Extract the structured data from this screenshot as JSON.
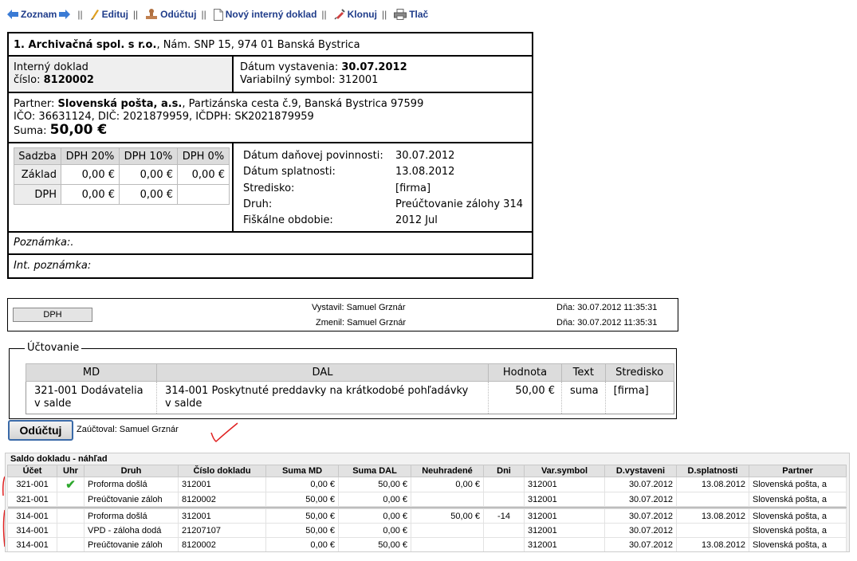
{
  "toolbar": {
    "zoznam": "Zoznam",
    "edituj": "Edituj",
    "oductuj": "Odúčtuj",
    "novy": "Nový interný doklad",
    "klonuj": "Klonuj",
    "tlac": "Tlač",
    "sep": "||"
  },
  "doc": {
    "company_name": "1. Archivačná spol. s r.o.",
    "company_addr": ", Nám. SNP 15, 974 01 Banská Bystrica",
    "type_label": "Interný doklad",
    "number_label": "číslo:",
    "number": "8120002",
    "issue_label": "Dátum vystavenia:",
    "issue_date": "30.07.2012",
    "vs_label": "Variabilný symbol:",
    "vs": "312001",
    "partner_label": "Partner:",
    "partner_name": "Slovenská pošta, a.s.",
    "partner_addr": ", Partizánska cesta č.9, Banská Bystrica 97599",
    "ids": "IČO: 36631124, DIČ: 2021879959, IČDPH: SK2021879959",
    "suma_label": "Suma:",
    "suma": "50,00 €",
    "vat": {
      "h0": "Sadzba",
      "h1": "DPH 20%",
      "h2": "DPH 10%",
      "h3": "DPH 0%",
      "r1": "Základ",
      "r1v1": "0,00 €",
      "r1v2": "0,00 €",
      "r1v3": "0,00 €",
      "r2": "DPH",
      "r2v1": "0,00 €",
      "r2v2": "0,00 €"
    },
    "kv": [
      {
        "k": "Dátum daňovej povinnosti:",
        "v": "30.07.2012"
      },
      {
        "k": "Dátum splatnosti:",
        "v": "13.08.2012"
      },
      {
        "k": "Stredisko:",
        "v": "[firma]"
      },
      {
        "k": "Druh:",
        "v": "Preúčtovanie zálohy 314"
      },
      {
        "k": "Fiškálne obdobie:",
        "v": "2012 Jul"
      }
    ],
    "note": "Poznámka:.",
    "int_note": "Int. poznámka:"
  },
  "meta": {
    "dph_btn": "DPH",
    "vystavil": "Vystavil: Samuel Grznár",
    "zmenil": "Zmenil: Samuel Grznár",
    "dna1": "Dňa: 30.07.2012 11:35:31",
    "dna2": "Dňa: 30.07.2012 11:35:31"
  },
  "uctovanie": {
    "legend": "Účtovanie",
    "headers": [
      "MD",
      "DAL",
      "Hodnota",
      "Text",
      "Stredisko"
    ],
    "row": {
      "md1": "321-001 Dodávatelia",
      "md2": "v salde",
      "dal1": "314-001 Poskytnuté preddavky na krátkodobé pohľadávky",
      "dal2": "v salde",
      "hodnota": "50,00 €",
      "text": "suma",
      "stredisko": "[firma]"
    }
  },
  "oductuj_button": "Odúčtuj",
  "zauctoval": "Zaúčtoval: Samuel Grznár",
  "saldo": {
    "title": "Saldo dokladu - náhľad",
    "headers": [
      "Účet",
      "Uhr",
      "Druh",
      "Číslo dokladu",
      "Suma MD",
      "Suma DAL",
      "Neuhradené",
      "Dni",
      "Var.symbol",
      "D.vystaveni",
      "D.splatnosti",
      "Partner"
    ],
    "rows": [
      [
        "321-001",
        "✔",
        "Proforma došlá",
        "312001",
        "0,00 €",
        "50,00 €",
        "0,00 €",
        "",
        "312001",
        "30.07.2012",
        "13.08.2012",
        "Slovenská pošta, a"
      ],
      [
        "321-001",
        "",
        "Preúčtovanie záloh",
        "8120002",
        "50,00 €",
        "0,00 €",
        "",
        "",
        "312001",
        "30.07.2012",
        "",
        "Slovenská pošta, a"
      ],
      [
        "314-001",
        "",
        "Proforma došlá",
        "312001",
        "50,00 €",
        "0,00 €",
        "50,00 €",
        "-14",
        "312001",
        "30.07.2012",
        "13.08.2012",
        "Slovenská pošta, a"
      ],
      [
        "314-001",
        "",
        "VPD - záloha dodá",
        "21207107",
        "50,00 €",
        "0,00 €",
        "",
        "",
        "312001",
        "30.07.2012",
        "",
        "Slovenská pošta, a"
      ],
      [
        "314-001",
        "",
        "Preúčtovanie záloh",
        "8120002",
        "0,00 €",
        "50,00 €",
        "",
        "",
        "312001",
        "30.07.2012",
        "13.08.2012",
        "Slovenská pošta, a"
      ]
    ]
  },
  "colors": {
    "link": "#1f3c8a",
    "check": "#2ea82e",
    "annotation": "#e02020",
    "button_border": "#3a6aa8"
  }
}
